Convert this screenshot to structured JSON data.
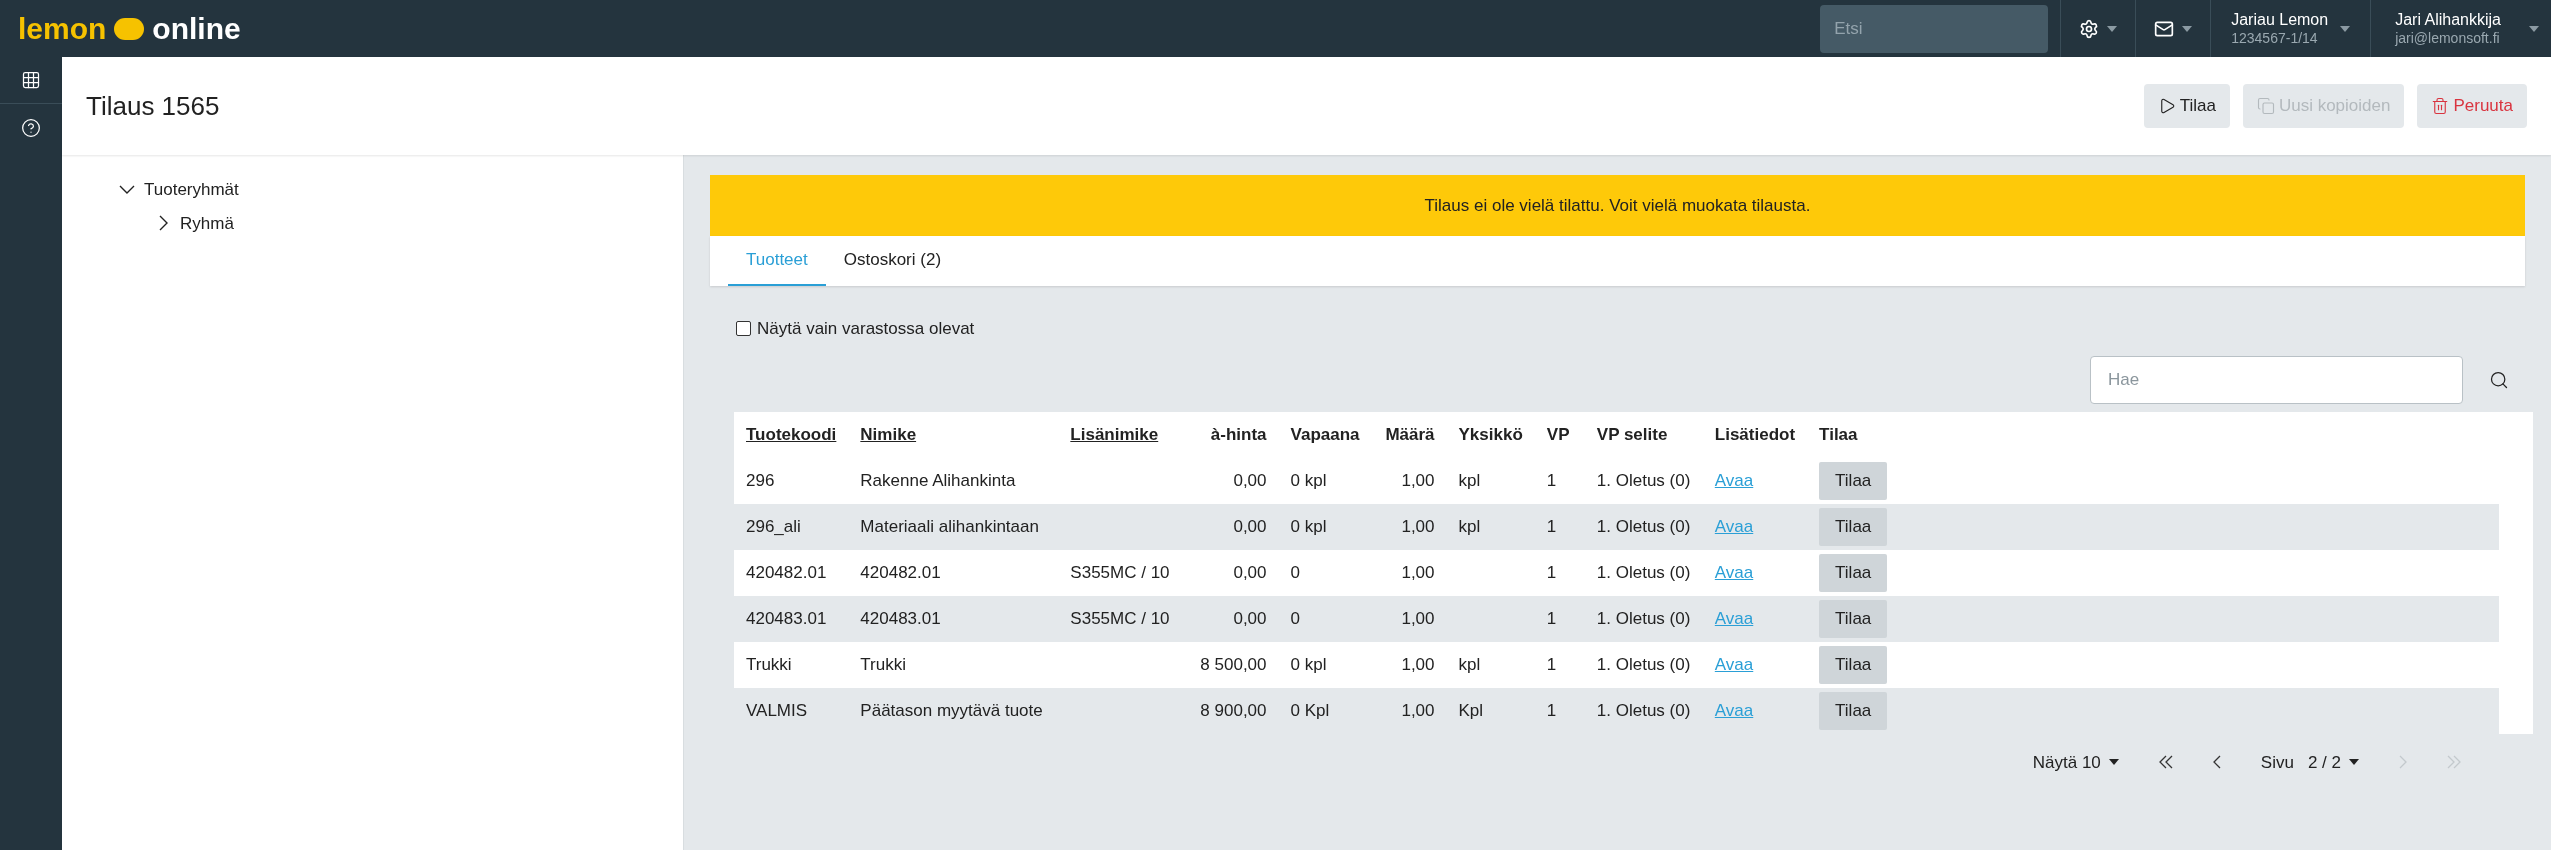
{
  "topbar": {
    "logo_left": "lemon",
    "logo_right": "online",
    "search": {
      "placeholder": "Etsi"
    },
    "company": {
      "name": "Jariau Lemon",
      "code": "1234567-1/14"
    },
    "user": {
      "name": "Jari Alihankkija",
      "email": "jari@lemonsoft.fi"
    }
  },
  "page": {
    "title": "Tilaus 1565",
    "actions": [
      {
        "kind": "play",
        "label": "Tilaa",
        "disabled": false
      },
      {
        "kind": "copy",
        "label": "Uusi kopioiden",
        "disabled": true
      },
      {
        "kind": "delete",
        "label": "Peruuta",
        "disabled": false
      }
    ]
  },
  "tree": [
    {
      "label": "Tuoteryhmät",
      "expanded": true,
      "children": [
        {
          "label": "Ryhmä",
          "expanded": false
        }
      ]
    }
  ],
  "alert": "Tilaus ei ole vielä tilattu. Voit vielä muokata tilausta.",
  "tabs": [
    {
      "label": "Tuotteet",
      "selected": true
    },
    {
      "label": "Ostoskori (2)",
      "selected": false
    }
  ],
  "filter": {
    "label": "Näytä vain varastossa olevat",
    "checked": false
  },
  "table_search": {
    "placeholder": "Hae"
  },
  "table": {
    "columns": [
      {
        "label": "Tuotekoodi",
        "sortable": true,
        "kind": "text"
      },
      {
        "label": "Nimike",
        "sortable": true,
        "kind": "text"
      },
      {
        "label": "Lisänimike",
        "sortable": true,
        "kind": "text"
      },
      {
        "label": "à-hinta",
        "sortable": false,
        "kind": "number"
      },
      {
        "label": "Vapaana",
        "sortable": false,
        "kind": "text"
      },
      {
        "label": "Määrä",
        "sortable": false,
        "kind": "number"
      },
      {
        "label": "Yksikkö",
        "sortable": false,
        "kind": "text"
      },
      {
        "label": "VP",
        "sortable": false,
        "kind": "text"
      },
      {
        "label": "VP selite",
        "sortable": false,
        "kind": "text"
      },
      {
        "label": "Lisätiedot",
        "sortable": false,
        "kind": "text"
      },
      {
        "label": "Tilaa",
        "sortable": false,
        "kind": "text"
      }
    ],
    "rows": [
      {
        "cells": [
          "296",
          "Rakenne Alihankinta",
          "",
          "0,00",
          "0 kpl",
          "1,00",
          "kpl",
          "1",
          "1. Oletus (0)"
        ],
        "link": "Avaa",
        "button": "Tilaa"
      },
      {
        "cells": [
          "296_ali",
          "Materiaali alihankintaan",
          "",
          "0,00",
          "0 kpl",
          "1,00",
          "kpl",
          "1",
          "1. Oletus (0)"
        ],
        "link": "Avaa",
        "button": "Tilaa"
      },
      {
        "cells": [
          "420482.01",
          "420482.01",
          "S355MC / 10",
          "0,00",
          "0",
          "1,00",
          "",
          "1",
          "1. Oletus (0)"
        ],
        "link": "Avaa",
        "button": "Tilaa"
      },
      {
        "cells": [
          "420483.01",
          "420483.01",
          "S355MC / 10",
          "0,00",
          "0",
          "1,00",
          "",
          "1",
          "1. Oletus (0)"
        ],
        "link": "Avaa",
        "button": "Tilaa"
      },
      {
        "cells": [
          "Trukki",
          "Trukki",
          "",
          "8 500,00",
          "0 kpl",
          "1,00",
          "kpl",
          "1",
          "1. Oletus (0)"
        ],
        "link": "Avaa",
        "button": "Tilaa"
      },
      {
        "cells": [
          "VALMIS",
          "Päätason myytävä tuote",
          "",
          "8 900,00",
          "0 Kpl",
          "1,00",
          "Kpl",
          "1",
          "1. Oletus (0)"
        ],
        "link": "Avaa",
        "button": "Tilaa"
      }
    ]
  },
  "pagination": {
    "page_size": "Näytä 10",
    "page_label": "Sivu",
    "page": "2 / 2",
    "first_disabled": false,
    "prev_disabled": false,
    "next_disabled": true,
    "last_disabled": true
  }
}
